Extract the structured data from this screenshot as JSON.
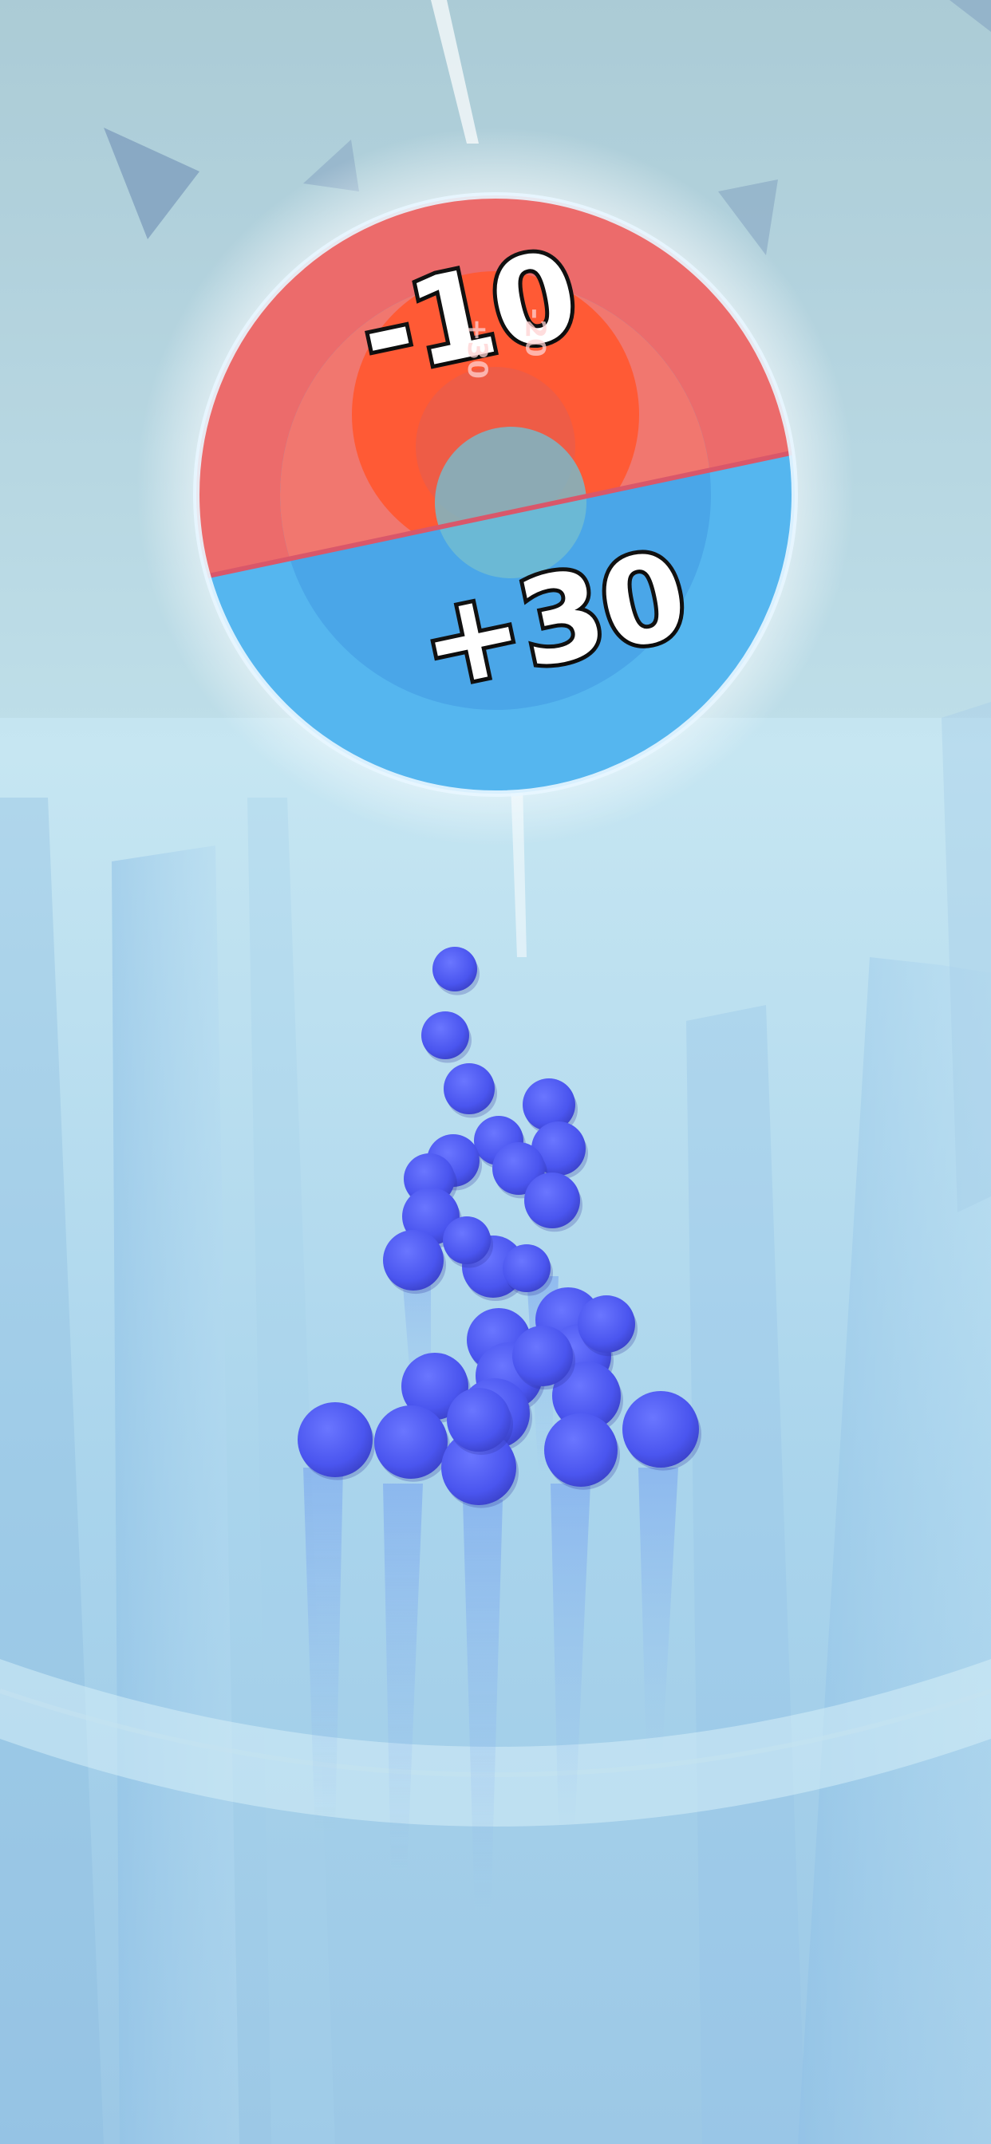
{
  "gate": {
    "negative_value": "-10",
    "positive_value": "+30",
    "inner_negative_value": "-20",
    "inner_positive_value": "+30"
  },
  "balls": {
    "count": 30,
    "color": "#4a55ef"
  },
  "colors": {
    "background": "#bfe0ee",
    "gate_red": "#ec6b6b",
    "gate_red_inner": "#ff5a35",
    "gate_blue": "#55b6ef",
    "gate_blue_inner": "#4aa6e8",
    "ball": "#4a55ef"
  }
}
